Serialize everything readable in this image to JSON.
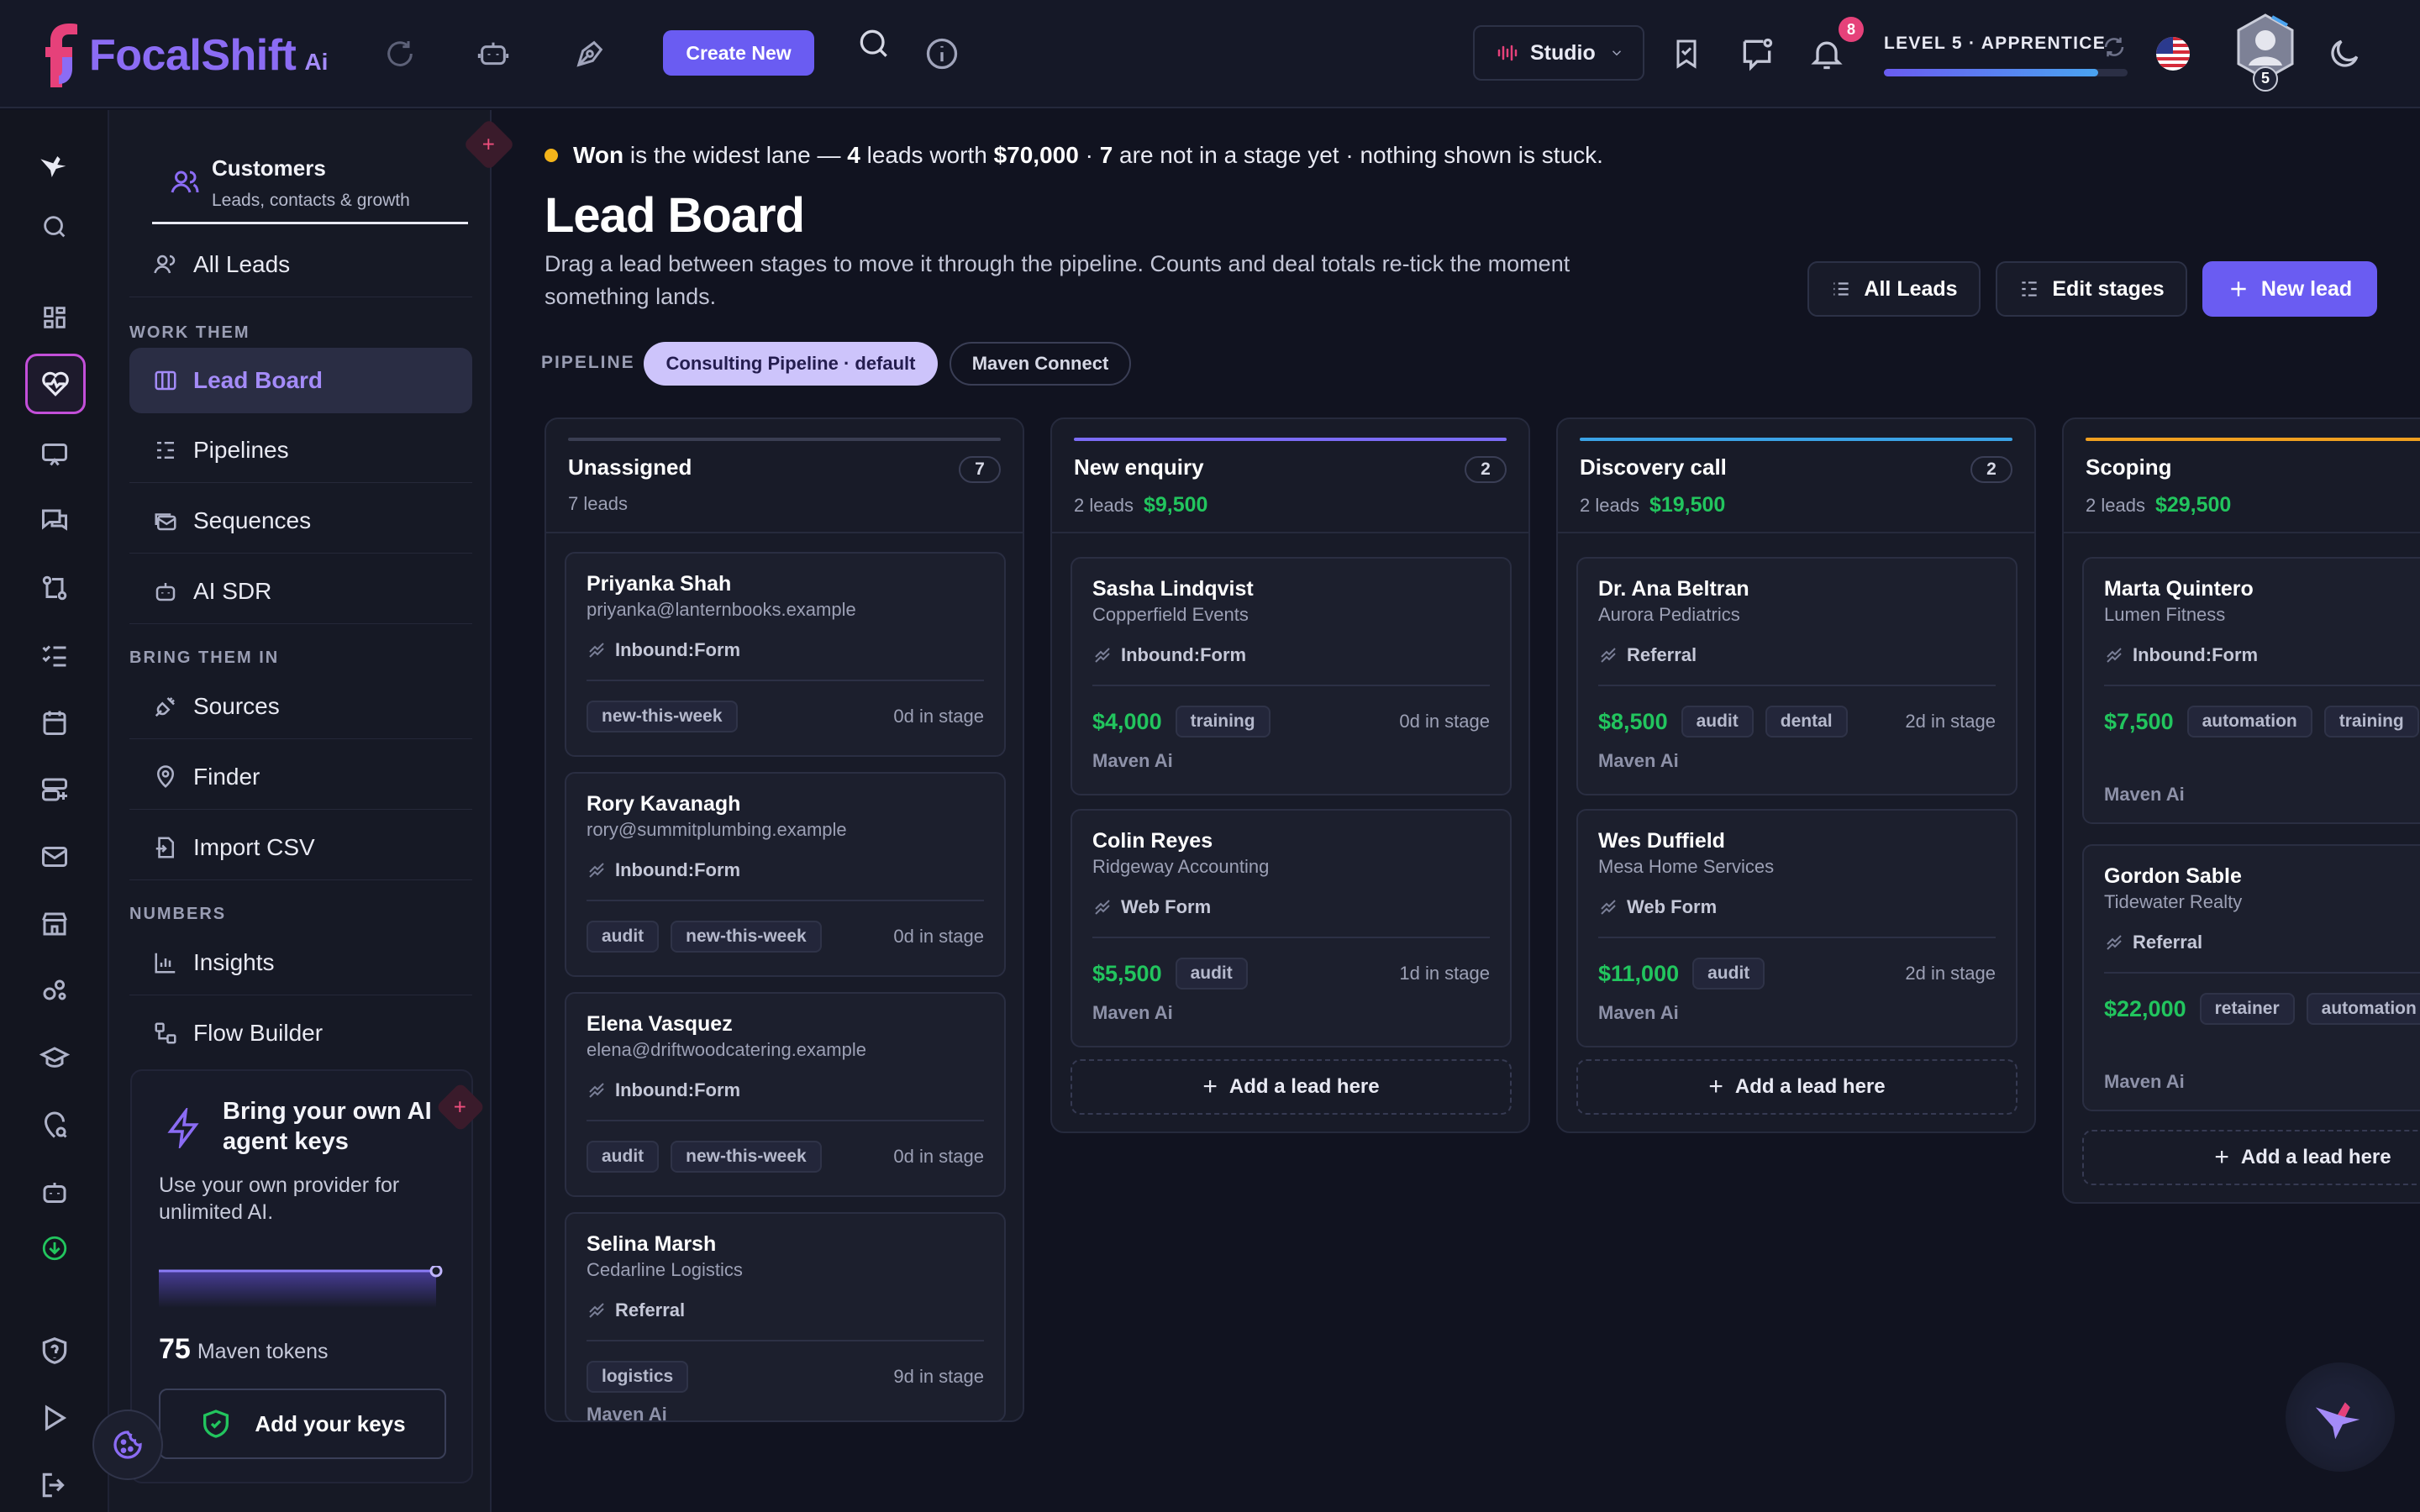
{
  "app": {
    "name": "FocalShift",
    "name_suffix": "Ai"
  },
  "topbar": {
    "create_label": "Create New",
    "studio_label": "Studio",
    "notif_count": "8",
    "level_label": "LEVEL 5 · APPRENTICE",
    "level_progress": 0.88,
    "avatar_level": "5"
  },
  "sidepanel": {
    "title": "Customers",
    "subtitle": "Leads, contacts & growth",
    "top_item": "All Leads",
    "sections": [
      {
        "label": "WORK THEM",
        "items": [
          "Lead Board",
          "Pipelines",
          "Sequences",
          "AI SDR"
        ]
      },
      {
        "label": "BRING THEM IN",
        "items": [
          "Sources",
          "Finder",
          "Import CSV"
        ]
      },
      {
        "label": "NUMBERS",
        "items": [
          "Insights",
          "Flow Builder"
        ]
      }
    ],
    "active_item": "Lead Board"
  },
  "promo": {
    "title": "Bring your own AI agent keys",
    "text": "Use your own provider for unlimited AI.",
    "token_count": "75",
    "token_label": "Maven tokens",
    "button_label": "Add your keys"
  },
  "main": {
    "banner": {
      "p1": "Won",
      "p2": " is the widest lane — ",
      "p3": "4",
      "p4": " leads worth ",
      "p5": "$70,000",
      "p6": " · ",
      "p7": "7",
      "p8": " are not in a stage yet · nothing shown is stuck."
    },
    "title": "Lead Board",
    "description": "Drag a lead between stages to move it through the pipeline. Counts and deal totals re-tick the moment something lands.",
    "buttons": {
      "all_leads": "All Leads",
      "edit_stages": "Edit stages",
      "new_lead": "New lead"
    },
    "pipeline_label": "PIPELINE",
    "pipelines": [
      "Consulting Pipeline · default",
      "Maven Connect"
    ]
  },
  "colors": {
    "accent": "#6a5cf2",
    "money": "#22c55e",
    "new_enquiry": "#7c6cf6",
    "discovery": "#3ba3e6",
    "scoping": "#f0a020",
    "unassigned": "#3a3e52"
  },
  "board": {
    "add_label": "Add a lead here",
    "columns": [
      {
        "title": "Unassigned",
        "count": "7",
        "leads": "7 leads",
        "amount": "",
        "cards": [
          {
            "name": "Priyanka Shah",
            "sub": "priyanka@lanternbooks.example",
            "source": "Inbound:Form",
            "amount": "",
            "tags": [
              "new-this-week"
            ],
            "days": "0d in stage",
            "owner": ""
          },
          {
            "name": "Rory Kavanagh",
            "sub": "rory@summitplumbing.example",
            "source": "Inbound:Form",
            "amount": "",
            "tags": [
              "audit",
              "new-this-week"
            ],
            "days": "0d in stage",
            "owner": ""
          },
          {
            "name": "Elena Vasquez",
            "sub": "elena@driftwoodcatering.example",
            "source": "Inbound:Form",
            "amount": "",
            "tags": [
              "audit",
              "new-this-week"
            ],
            "days": "0d in stage",
            "owner": ""
          },
          {
            "name": "Selina Marsh",
            "sub": "Cedarline Logistics",
            "source": "Referral",
            "amount": "",
            "tags": [
              "logistics"
            ],
            "days": "9d in stage",
            "owner": "Maven Ai"
          }
        ]
      },
      {
        "title": "New enquiry",
        "count": "2",
        "leads": "2 leads",
        "amount": "$9,500",
        "cards": [
          {
            "name": "Sasha Lindqvist",
            "sub": "Copperfield Events",
            "source": "Inbound:Form",
            "amount": "$4,000",
            "tags": [
              "training"
            ],
            "days": "0d in stage",
            "owner": "Maven Ai"
          },
          {
            "name": "Colin Reyes",
            "sub": "Ridgeway Accounting",
            "source": "Web Form",
            "amount": "$5,500",
            "tags": [
              "audit"
            ],
            "days": "1d in stage",
            "owner": "Maven Ai"
          }
        ]
      },
      {
        "title": "Discovery call",
        "count": "2",
        "leads": "2 leads",
        "amount": "$19,500",
        "cards": [
          {
            "name": "Dr. Ana Beltran",
            "sub": "Aurora Pediatrics",
            "source": "Referral",
            "amount": "$8,500",
            "tags": [
              "audit",
              "dental"
            ],
            "days": "2d in stage",
            "owner": "Maven Ai"
          },
          {
            "name": "Wes Duffield",
            "sub": "Mesa Home Services",
            "source": "Web Form",
            "amount": "$11,000",
            "tags": [
              "audit"
            ],
            "days": "2d in stage",
            "owner": "Maven Ai"
          }
        ]
      },
      {
        "title": "Scoping",
        "count": "",
        "leads": "2 leads",
        "amount": "$29,500",
        "cards": [
          {
            "name": "Marta Quintero",
            "sub": "Lumen Fitness",
            "source": "Inbound:Form",
            "amount": "$7,500",
            "tags": [
              "automation",
              "training"
            ],
            "days": "",
            "owner": "Maven Ai"
          },
          {
            "name": "Gordon Sable",
            "sub": "Tidewater Realty",
            "source": "Referral",
            "amount": "$22,000",
            "tags": [
              "retainer",
              "automation"
            ],
            "days": "",
            "owner": "Maven Ai"
          }
        ]
      }
    ]
  }
}
